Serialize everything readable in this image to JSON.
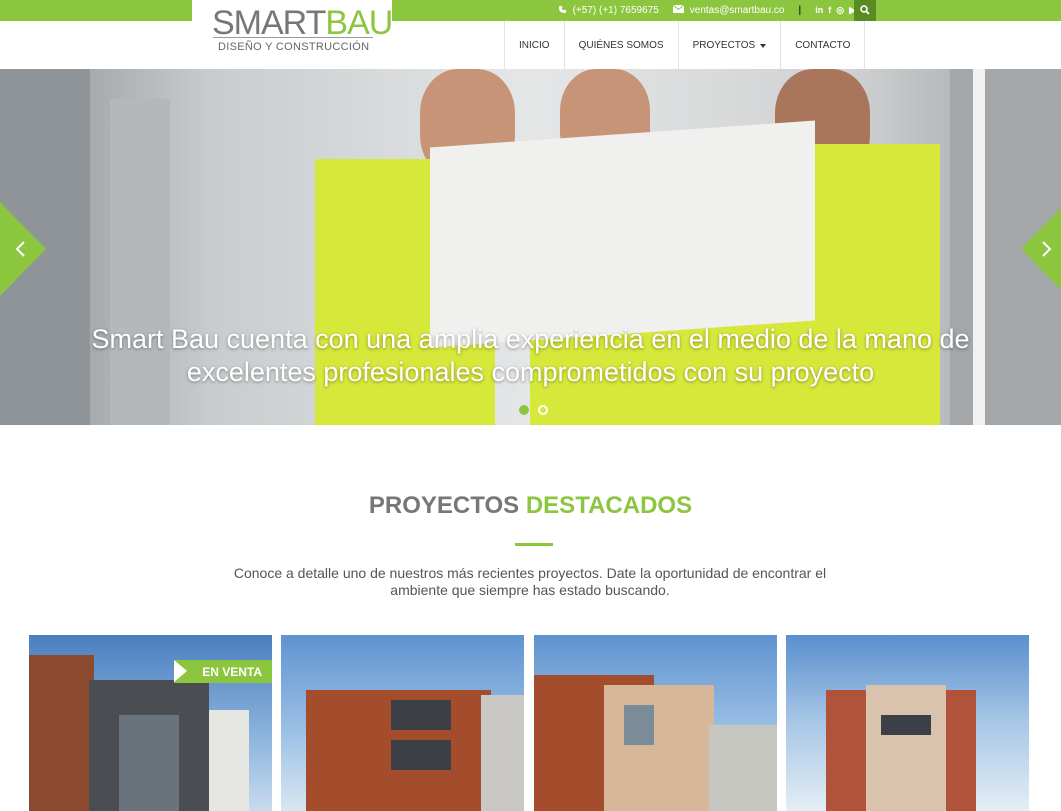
{
  "topbar": {
    "phone": "(+57) (+1) 7659675",
    "email": "ventas@smartbau.co",
    "separator": "|",
    "social": [
      "in",
      "f",
      "◎",
      "▶"
    ]
  },
  "logo": {
    "name_part1": "SMART",
    "name_part2": "BAU",
    "subtitle": "DISEÑO Y CONSTRUCCIÓN"
  },
  "nav": {
    "items": [
      {
        "label": "INICIO"
      },
      {
        "label": "QUIÉNES SOMOS"
      },
      {
        "label": "PROYECTOS"
      },
      {
        "label": "CONTACTO"
      }
    ]
  },
  "hero": {
    "caption_line1": "Smart Bau cuenta con una amplia experiencia en el medio de la mano de",
    "caption_line2": "excelentes profesionales comprometidos con su proyecto",
    "slide_count": 2,
    "active_slide": 1
  },
  "projects": {
    "title_part1": "PROYECTOS",
    "title_part2": "DESTACADOS",
    "intro_line1": "Conoce a detalle uno de nuestros más recientes proyectos. Date la oportunidad de encontrar el",
    "intro_line2": "ambiente que siempre has estado buscando.",
    "badge": "EN VENTA"
  },
  "colors": {
    "accent": "#8cc63f",
    "dark_accent": "#5a8a22"
  }
}
